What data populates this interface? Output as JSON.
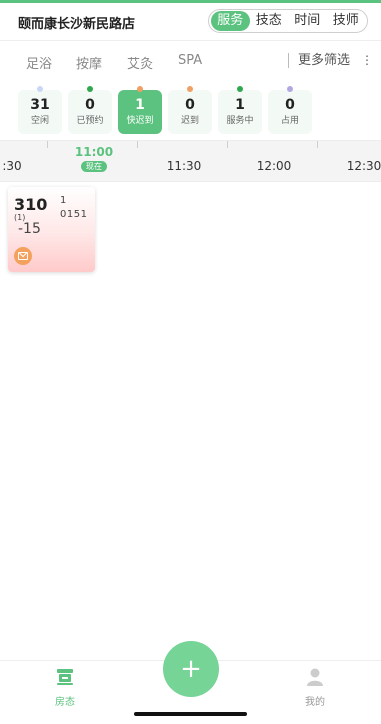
{
  "header": {
    "store_name": "颐而康长沙新民路店",
    "segments": [
      "服务",
      "技态",
      "时间",
      "技师"
    ],
    "active_segment": "服务"
  },
  "categories": [
    "足浴",
    "按摩",
    "艾灸",
    "SPA"
  ],
  "more_filter": {
    "label": "更多筛选",
    "icon": "⋮"
  },
  "stats": [
    {
      "count": "31",
      "label": "空闲",
      "dot_color": "#c9d6f7"
    },
    {
      "count": "0",
      "label": "已预约",
      "dot_color": "#2fa84f"
    },
    {
      "count": "1",
      "label": "快迟到",
      "dot_color": "#f0a065",
      "active": true
    },
    {
      "count": "0",
      "label": "迟到",
      "dot_color": "#f0a065"
    },
    {
      "count": "1",
      "label": "服务中",
      "dot_color": "#2fa84f"
    },
    {
      "count": "0",
      "label": "占用",
      "dot_color": "#b3a7e3"
    }
  ],
  "timeline": {
    "labels": [
      ":30",
      "11:30",
      "12:00",
      "12:30"
    ],
    "now_time": "11:00",
    "now_badge": "现在"
  },
  "room": {
    "number": "310",
    "sub": "(1)",
    "diff": "-15",
    "count": "1",
    "code": "0151",
    "icon": "envelope-icon"
  },
  "tabbar": {
    "home_label": "房态",
    "mine_label": "我的",
    "fab_label": "+"
  },
  "colors": {
    "accent": "#5cc27f",
    "fab": "#76d496",
    "orange": "#f5a15e"
  }
}
